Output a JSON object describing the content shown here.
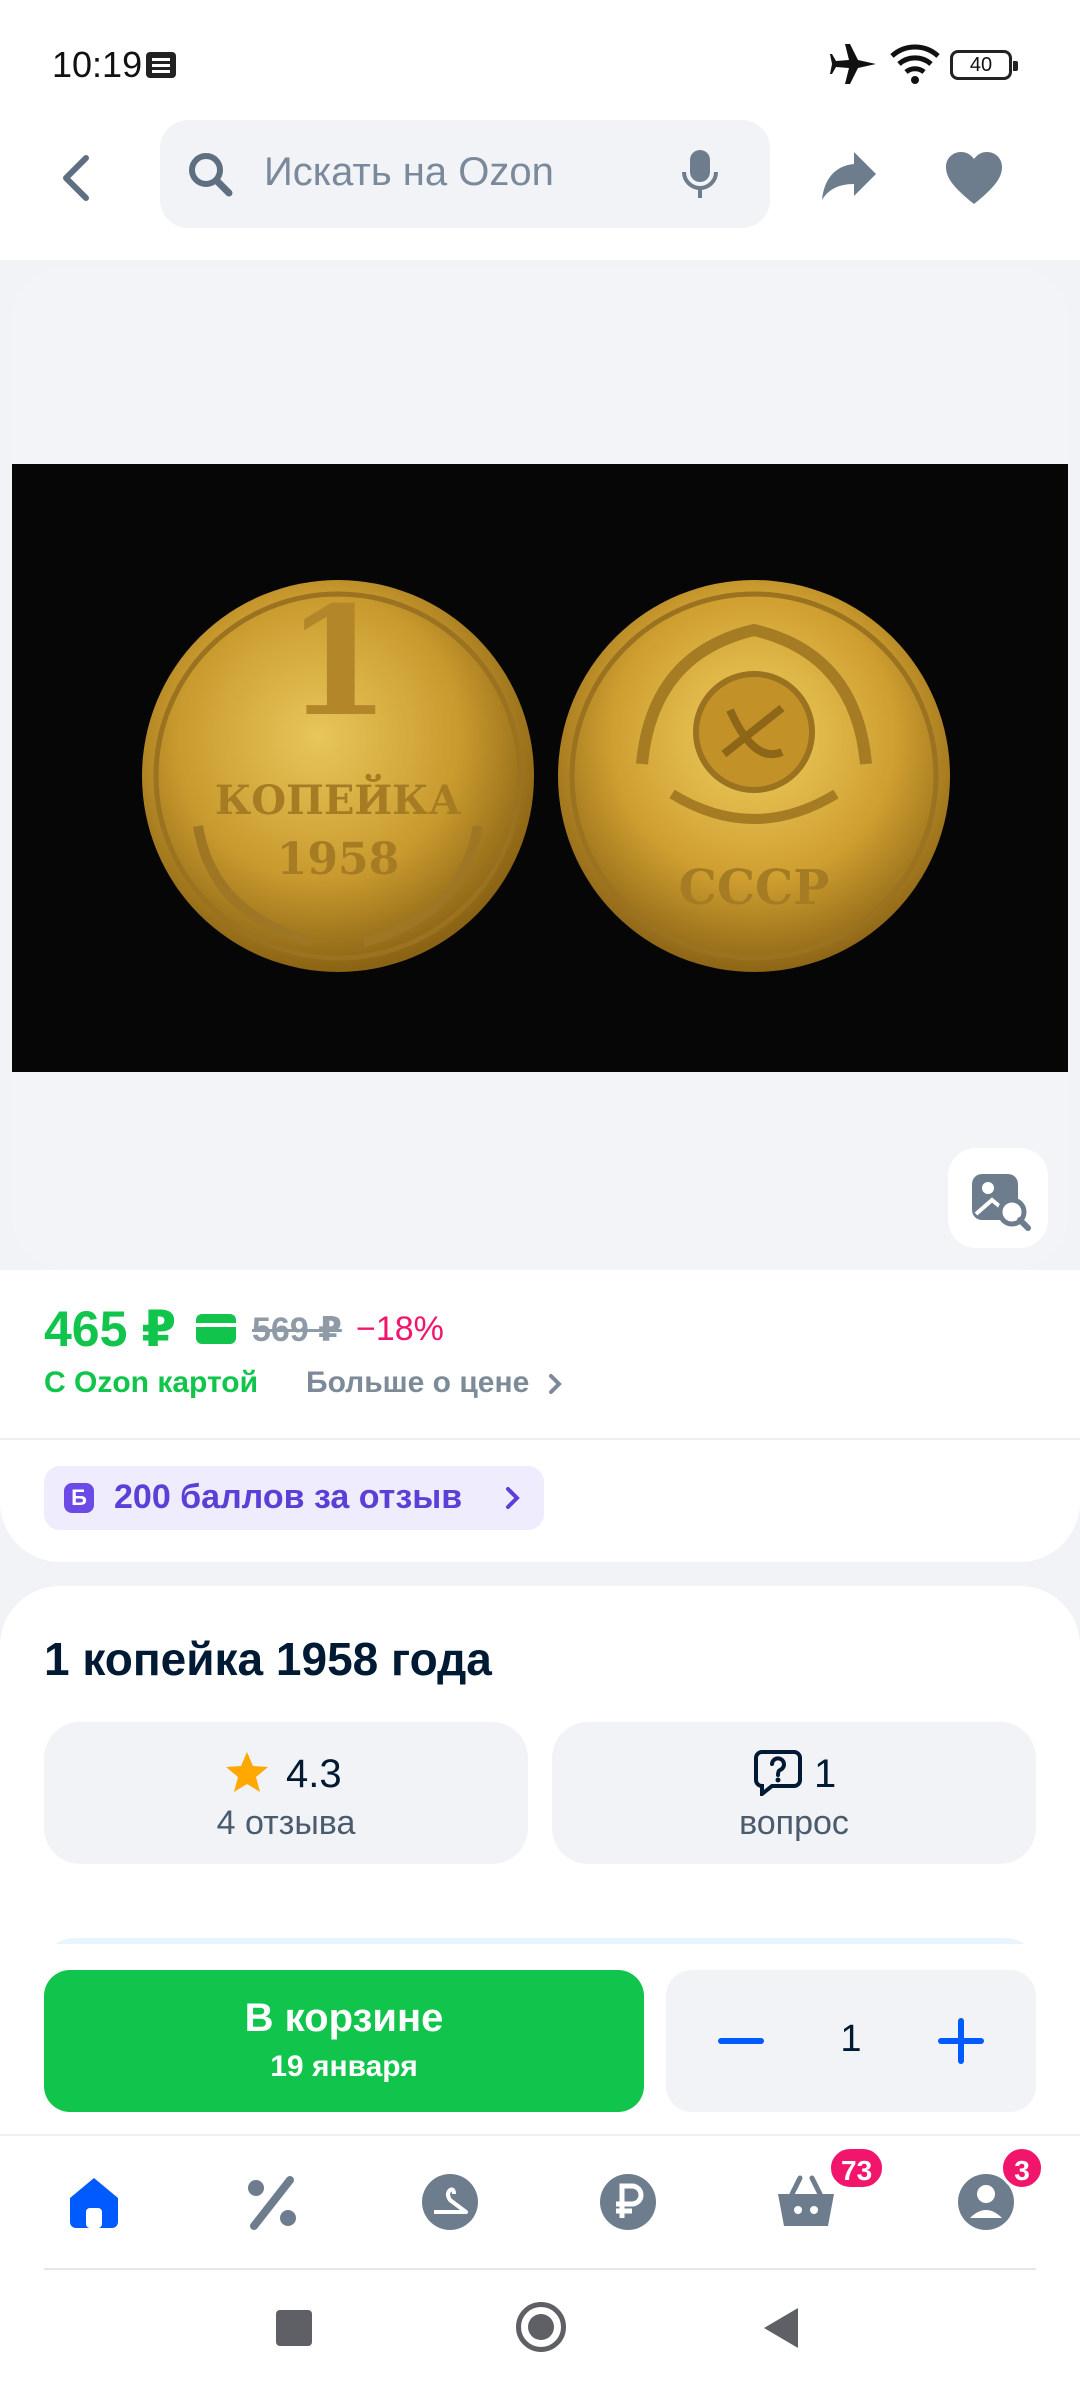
{
  "status_bar": {
    "time": "10:19",
    "battery": "40"
  },
  "search": {
    "placeholder": "Искать на Ozon"
  },
  "coin_left": {
    "denomination": "1",
    "word": "КОПЕЙКА",
    "year": "1958"
  },
  "coin_right": {
    "emblem_text": "СССР"
  },
  "price": {
    "current": "465 ₽",
    "old": "569 ₽",
    "discount": "−18%",
    "ozon_card_label": "С Ozon картой",
    "more_label": "Больше о цене"
  },
  "points": {
    "icon_letter": "Б",
    "label": "200 баллов за отзыв"
  },
  "product": {
    "title": "1 копейка 1958 года",
    "rating": "4.3",
    "reviews": "4 отзыва",
    "questions_count": "1",
    "questions_label": "вопрос"
  },
  "cart": {
    "button_label": "В корзине",
    "delivery_date": "19 января",
    "quantity": "1"
  },
  "bottom_nav": {
    "cart_badge": "73",
    "profile_badge": "3"
  },
  "colors": {
    "accent_green": "#10c44c",
    "accent_blue": "#005bff",
    "badge_pink": "#f2156c",
    "points_purple": "#5c3fd6"
  }
}
